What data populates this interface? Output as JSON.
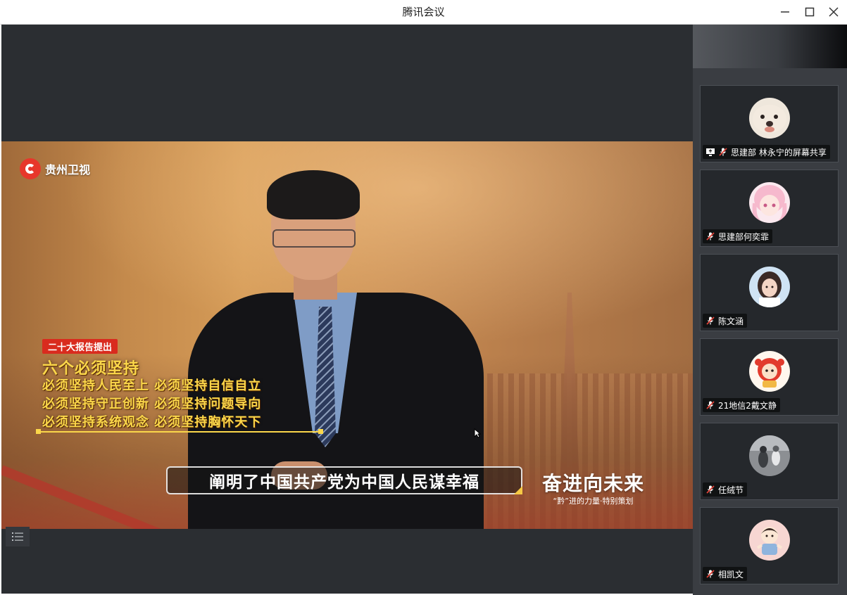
{
  "window": {
    "title": "腾讯会议"
  },
  "video": {
    "channel": "贵州卫视",
    "tag": "二十大报告提出",
    "headline": "六个必须坚持",
    "lines": [
      "必须坚持人民至上 必须坚持自信自立",
      "必须坚持守正创新 必须坚持问题导向",
      "必须坚持系统观念 必须坚持胸怀天下"
    ],
    "subtitle": "阐明了中国共产党为中国人民谋幸福",
    "brand_title": "奋进向未来",
    "brand_sub": "“黔”进的力量·特别策划"
  },
  "participants": [
    {
      "name": "思建部 林永宁的屏幕共享",
      "avatar": "puppy-avatar",
      "sharing": true,
      "muted": true
    },
    {
      "name": "思建部何奕霏",
      "avatar": "anime-girl-avatar",
      "sharing": false,
      "muted": true
    },
    {
      "name": "陈文涵",
      "avatar": "girl-photo-avatar",
      "sharing": false,
      "muted": true
    },
    {
      "name": "21地信2戴文静",
      "avatar": "red-cartoon-avatar",
      "sharing": false,
      "muted": true
    },
    {
      "name": "任绒节",
      "avatar": "bw-photo-avatar",
      "sharing": false,
      "muted": true
    },
    {
      "name": "相凯文",
      "avatar": "cartoon-boy-avatar",
      "sharing": false,
      "muted": true
    }
  ],
  "colors": {
    "titlebar_bg": "#ffffff",
    "stage_bg": "#2b2e32",
    "panel_bg": "#3a3d42",
    "tile_bg": "#25282c",
    "mute_red": "#e0443a",
    "overlay_gold": "#fbd74a"
  }
}
